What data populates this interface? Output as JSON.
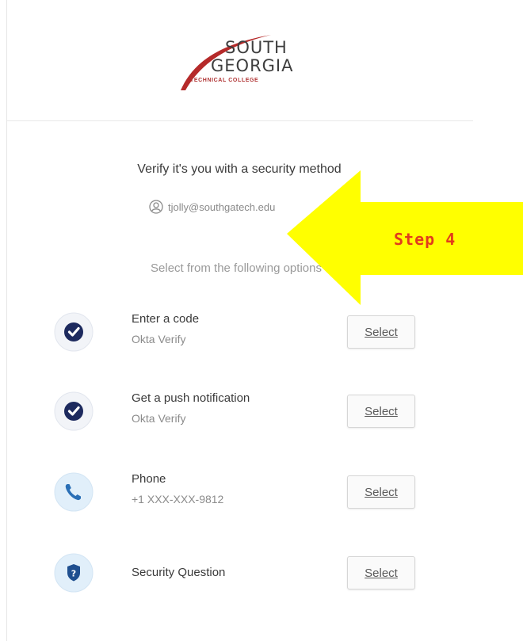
{
  "brand": {
    "line1": "SOUTH",
    "line2": "GEORGIA",
    "line3": "TECHNICAL COLLEGE",
    "swoosh_color": "#b52a2a"
  },
  "heading": "Verify it's you with a security method",
  "user": {
    "icon": "user-circle-icon",
    "email": "tjolly@southgatech.edu"
  },
  "instruction": "Select from the following options",
  "options": [
    {
      "icon": "okta-verify-icon",
      "title": "Enter a code",
      "subtitle": "Okta Verify",
      "button": "Select"
    },
    {
      "icon": "okta-verify-icon",
      "title": "Get a push notification",
      "subtitle": "Okta Verify",
      "button": "Select"
    },
    {
      "icon": "phone-icon",
      "title": "Phone",
      "subtitle": "+1 XXX-XXX-9812",
      "button": "Select"
    },
    {
      "icon": "shield-question-icon",
      "title": "Security Question",
      "subtitle": "",
      "button": "Select"
    }
  ],
  "annotation": {
    "label": "Step 4",
    "arrow_color": "#ffff00",
    "text_color": "#e23c1c"
  }
}
